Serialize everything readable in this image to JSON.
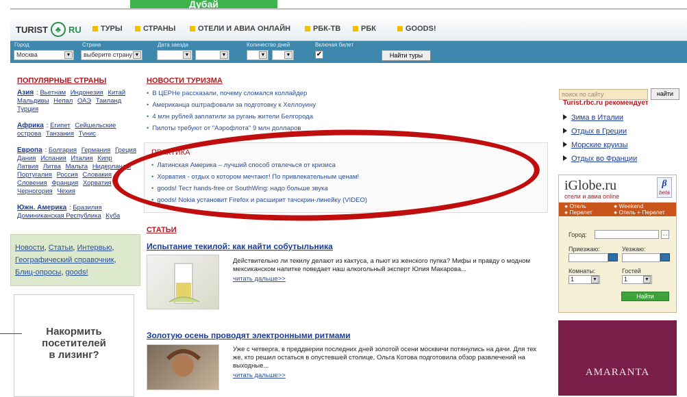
{
  "top_banner": "Дубай",
  "nav": {
    "logo_text": "TURIST",
    "logo_suffix": "RU",
    "items": [
      "ТУРЫ",
      "СТРАНЫ",
      "ОТЕЛИ И АВИА ОНЛАЙН",
      "РБК-ТВ",
      "РБК",
      "GOODS!"
    ]
  },
  "search_bar": {
    "labels": {
      "city": "Город",
      "country": "Страна",
      "date": "Дата заезда",
      "days": "Количество дней",
      "ticket": "Включая билет"
    },
    "city_value": "Москва",
    "country_value": "выберите страну",
    "ticket_checked": "✔",
    "find_button": "Найти туры"
  },
  "popular": {
    "title": "ПОПУЛЯРНЫЕ СТРАНЫ",
    "regions": [
      {
        "name": "Азия",
        "countries": [
          "Вьетнам",
          "Индонезия",
          "Китай",
          "Мальдивы",
          "Непал",
          "ОАЭ",
          "Таиланд",
          "Турция"
        ]
      },
      {
        "name": "Африка",
        "countries": [
          "Египет",
          "Сейшельские острова",
          "Танзания",
          "Тунис"
        ]
      },
      {
        "name": "Европа",
        "countries": [
          "Болгария",
          "Германия",
          "Греция",
          "Дания",
          "Испания",
          "Италия",
          "Кипр",
          "Латвия",
          "Литва",
          "Мальта",
          "Нидерланды",
          "Португалия",
          "Россия",
          "Словакия",
          "Словения",
          "Франция",
          "Хорватия",
          "Черногория",
          "Чехия"
        ]
      },
      {
        "name": "Южн. Америка",
        "countries": [
          "Бразилия",
          "Доминиканская Республика",
          "Куба"
        ]
      }
    ]
  },
  "quick_links": [
    "Новости",
    "Статьи",
    "Интервью",
    "Географический справочник",
    "Блиц-опросы",
    "goods!"
  ],
  "left_ad": {
    "line1": "Накормить",
    "line2": "посетителей",
    "line3": "в лизинг?"
  },
  "news": {
    "title": "НОВОСТИ ТУРИЗМА",
    "items": [
      "В ЦЕРНе рассказали, почему сломался коллайдер",
      "Американца оштрафовали за подготовку к Хеллоуину",
      "4 млн рублей заплатили за ругань жители Белгорода",
      "Пилоты требуют от \"Аэрофлота\" 9 млн долларов"
    ]
  },
  "practice": {
    "title": "ПРАКТИКА",
    "items": [
      "Латинская Америка – лучший способ отвлечься от кризиса",
      "Хорватия - отдых о котором мечтают! По привлекательным ценам!",
      "goods! Тест hands-free от SouthWing: надо больше звука",
      "goods! Nokia установит Firefox и расширит тачскрин-линейку (VIDEO)"
    ]
  },
  "articles": {
    "title": "СТАТЬИ",
    "items": [
      {
        "headline": "Испытание текилой: как найти собутыльника",
        "text": "Действительно ли текилу делают из кактуса, а пьют из женского пупка? Мифы и правду о модном мексиканском напитке поведает наш алкогольный эксперт Юлия Макарова...",
        "more": "читать дальше>>"
      },
      {
        "headline": "Золотую осень проводят электронными ритмами",
        "text": "Уже с четверга, в преддверии последних дней золотой осени москвичи потянулись на дачи. Для тех же, кто решил остаться в опустевшей столице, Ольга Котова подготовила обзор развлечений на выходные...",
        "more": "читать дальше>>"
      }
    ]
  },
  "site_search": {
    "placeholder": "поиск по сайту",
    "button": "найти"
  },
  "recommends": {
    "title": "Turist.rbc.ru рекомендует",
    "items": [
      "Зима в Италии",
      "Отдых в Греции",
      "Морские круизы",
      "Отдых во Франции"
    ]
  },
  "iglobe": {
    "logo": "iGlobe.ru",
    "subtitle": "отели и авиа online",
    "beta": "β",
    "beta_label": "beta",
    "options": [
      "Отель",
      "Weekend",
      "Перелет",
      "Отель + Перелет"
    ],
    "city_label": "Город:",
    "arrive_label": "Приезжаю:",
    "leave_label": "Уезжаю:",
    "rooms_label": "Комнаты:",
    "guests_label": "Гостей",
    "rooms_value": "1",
    "guests_value": "1",
    "find_button": "Найти"
  },
  "right_ad": "AMARANTA"
}
